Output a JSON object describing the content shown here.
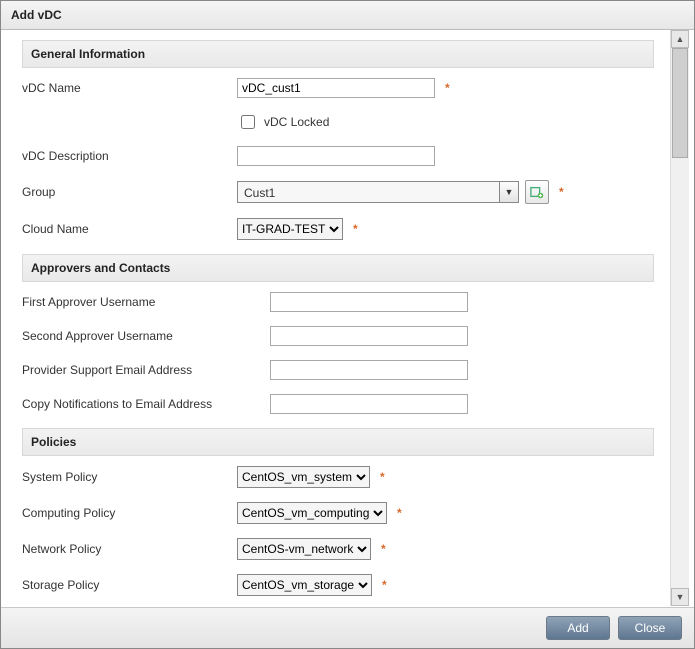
{
  "dialog_title": "Add vDC",
  "sections": {
    "general": "General Information",
    "approvers": "Approvers and Contacts",
    "policies": "Policies"
  },
  "fields": {
    "vdc_name_label": "vDC Name",
    "vdc_name_value": "vDC_cust1",
    "vdc_locked_label": "vDC Locked",
    "vdc_locked_checked": false,
    "vdc_desc_label": "vDC Description",
    "vdc_desc_value": "",
    "group_label": "Group",
    "group_value": "Cust1",
    "cloud_label": "Cloud Name",
    "cloud_value": "IT-GRAD-TEST",
    "first_approver_label": "First Approver Username",
    "first_approver_value": "",
    "second_approver_label": "Second Approver Username",
    "second_approver_value": "",
    "provider_email_label": "Provider Support Email Address",
    "provider_email_value": "",
    "copy_notif_label": "Copy Notifications to Email Address",
    "copy_notif_value": "",
    "system_policy_label": "System Policy",
    "system_policy_value": "CentOS_vm_system",
    "computing_policy_label": "Computing Policy",
    "computing_policy_value": "CentOS_vm_computing",
    "network_policy_label": "Network Policy",
    "network_policy_value": "CentOS-vm_network",
    "storage_policy_label": "Storage Policy",
    "storage_policy_value": "CentOS_vm_storage"
  },
  "required_mark": "*",
  "buttons": {
    "add": "Add",
    "close": "Close"
  },
  "icons": {
    "add_group": "add-group-icon"
  }
}
